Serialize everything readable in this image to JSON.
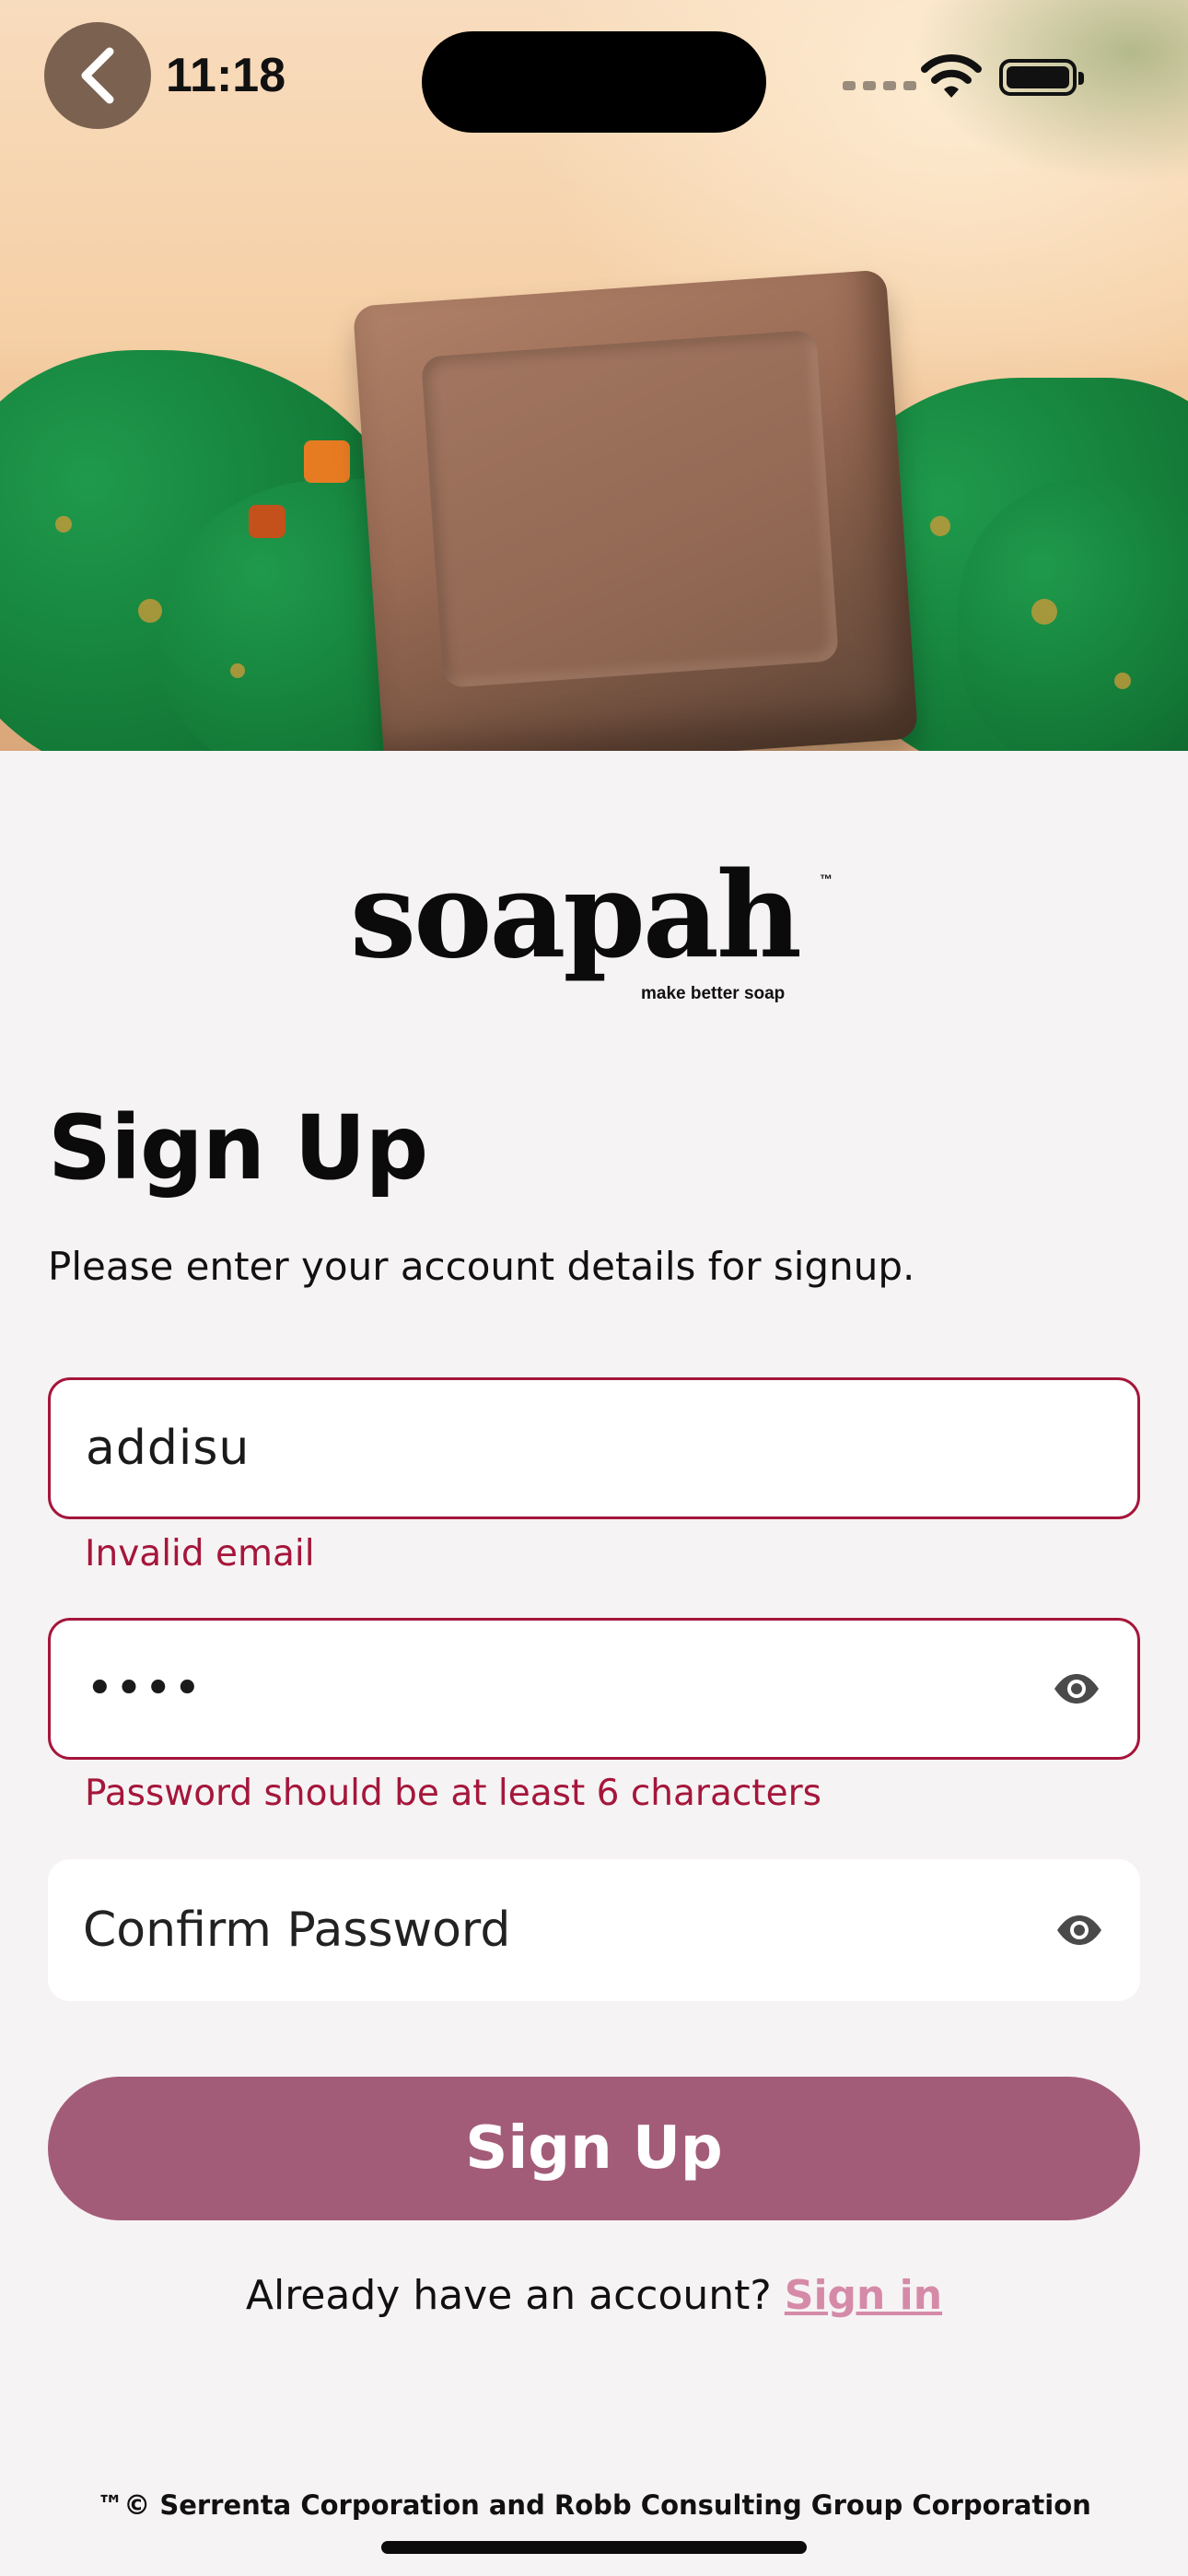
{
  "status_bar": {
    "time": "11:18"
  },
  "logo": {
    "wordmark": "soapah",
    "trademark": "™",
    "tagline": "make better soap"
  },
  "form": {
    "title": "Sign Up",
    "subtitle": "Please enter your account details for signup.",
    "email": {
      "value": "addisu",
      "error": "Invalid email"
    },
    "password": {
      "value": "••••",
      "error": "Password should be at least 6 characters"
    },
    "confirm_password": {
      "placeholder": "Confirm Password"
    },
    "submit_label": "Sign Up"
  },
  "signin": {
    "prompt": "Already have an account?",
    "link_label": "Sign in"
  },
  "footer": {
    "text": "™© Serrenta Corporation and Robb Consulting Group Corporation"
  },
  "colors": {
    "error": "#a5163b",
    "primary_button": "#a35c78",
    "link": "#d58aa8",
    "background": "#f6f3f4"
  }
}
